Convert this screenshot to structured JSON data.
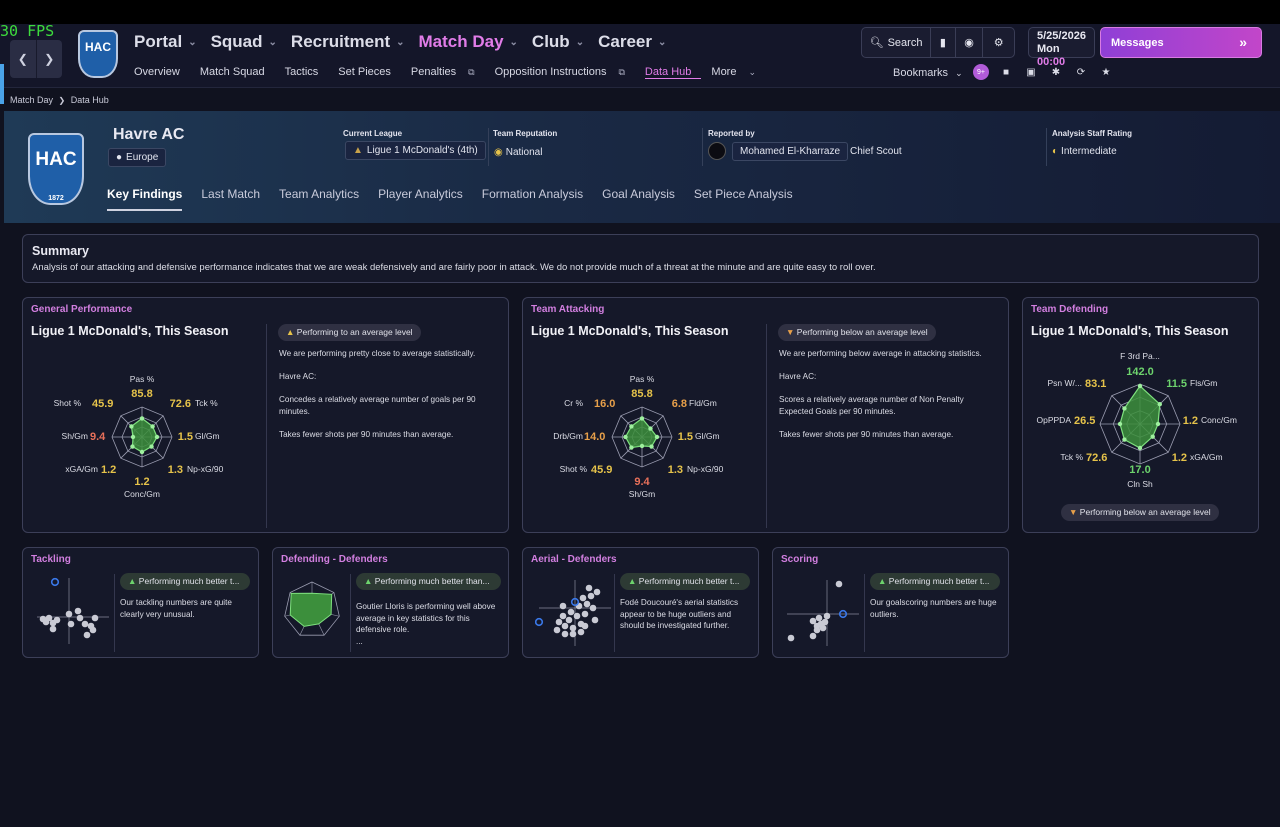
{
  "fps": "30 FPS",
  "nav": {
    "club_crest_text": "HAC",
    "menus": [
      {
        "label": "Portal"
      },
      {
        "label": "Squad"
      },
      {
        "label": "Recruitment"
      },
      {
        "label": "Match Day",
        "active": true
      },
      {
        "label": "Club"
      },
      {
        "label": "Career"
      }
    ],
    "submenu": [
      {
        "label": "Overview"
      },
      {
        "label": "Match Squad"
      },
      {
        "label": "Tactics"
      },
      {
        "label": "Set Pieces"
      },
      {
        "label": "Penalties",
        "external": true
      },
      {
        "label": "Opposition Instructions",
        "external": true
      },
      {
        "label": "Data Hub",
        "active": true
      },
      {
        "label": "More"
      }
    ],
    "search_label": "Search",
    "date": "5/25/2026",
    "day": "Mon",
    "time": "00:00",
    "messages_label": "Messages",
    "bookmarks_label": "Bookmarks",
    "notif_count": "9+"
  },
  "breadcrumb": {
    "parent": "Match Day",
    "current": "Data Hub"
  },
  "header": {
    "crest_text": "HAC",
    "crest_year": "1872",
    "club_name": "Havre AC",
    "region": "Europe",
    "current_league_label": "Current League",
    "current_league": "Ligue 1 McDonald's (4th)",
    "reputation_label": "Team Reputation",
    "reputation": "National",
    "reported_by_label": "Reported by",
    "scout_name": "Mohamed El-Kharraze",
    "scout_role": "Chief Scout",
    "staff_rating_label": "Analysis Staff Rating",
    "staff_rating": "Intermediate"
  },
  "tabs": [
    "Key Findings",
    "Last Match",
    "Team Analytics",
    "Player Analytics",
    "Formation Analysis",
    "Goal Analysis",
    "Set Piece Analysis"
  ],
  "summary": {
    "title": "Summary",
    "text": "Analysis of our attacking and defensive performance indicates that we are weak defensively and are fairly poor in attack. We do not provide much of a threat at the minute and are quite easy to roll over."
  },
  "general": {
    "title": "General Performance",
    "subtitle": "Ligue 1 McDonald's, This Season",
    "badge": "Performing to an average level",
    "lines": [
      "We are performing pretty close to average statistically.",
      "Havre AC:",
      "Concedes a relatively average number of goals per 90 minutes.",
      "Takes fewer shots per 90 minutes than average."
    ],
    "radar": [
      {
        "label": "Pas %",
        "value": "85.8",
        "color": "#e6c34a",
        "level": 0.62
      },
      {
        "label": "Tck %",
        "value": "72.6",
        "color": "#e6c34a",
        "level": 0.5
      },
      {
        "label": "Gl/Gm",
        "value": "1.5",
        "color": "#e6c34a",
        "level": 0.5
      },
      {
        "label": "Np-xG/90",
        "value": "1.3",
        "color": "#e6c34a",
        "level": 0.45
      },
      {
        "label": "Conc/Gm",
        "value": "1.2",
        "color": "#e6c34a",
        "level": 0.5
      },
      {
        "label": "xGA/Gm",
        "value": "1.2",
        "color": "#e6c34a",
        "level": 0.45
      },
      {
        "label": "Sh/Gm",
        "value": "9.4",
        "color": "#e8705a",
        "level": 0.3
      },
      {
        "label": "Shot %",
        "value": "45.9",
        "color": "#e6c34a",
        "level": 0.5
      }
    ]
  },
  "attacking": {
    "title": "Team Attacking",
    "subtitle": "Ligue 1 McDonald's, This Season",
    "badge": "Performing below an average level",
    "lines": [
      "We are performing below average in attacking statistics.",
      "Havre AC:",
      "Scores a relatively average number of Non Penalty Expected Goals per 90 minutes.",
      "Takes fewer shots per 90 minutes than average."
    ],
    "radar": [
      {
        "label": "Pas %",
        "value": "85.8",
        "color": "#e6c34a",
        "level": 0.62
      },
      {
        "label": "Fld/Gm",
        "value": "6.8",
        "color": "#e8a04a",
        "level": 0.4
      },
      {
        "label": "Gl/Gm",
        "value": "1.5",
        "color": "#e6c34a",
        "level": 0.5
      },
      {
        "label": "Np-xG/90",
        "value": "1.3",
        "color": "#e6c34a",
        "level": 0.45
      },
      {
        "label": "Sh/Gm",
        "value": "9.4",
        "color": "#e8705a",
        "level": 0.3
      },
      {
        "label": "Shot %",
        "value": "45.9",
        "color": "#e6c34a",
        "level": 0.5
      },
      {
        "label": "Drb/Gm",
        "value": "14.0",
        "color": "#e8a04a",
        "level": 0.55
      },
      {
        "label": "Cr %",
        "value": "16.0",
        "color": "#e8a04a",
        "level": 0.5
      }
    ]
  },
  "defending": {
    "title": "Team Defending",
    "subtitle": "Ligue 1 McDonald's, This Season",
    "badge": "Performing below an average level",
    "radar": [
      {
        "label": "F 3rd Pa...",
        "value": "142.0",
        "color": "#6dd36d",
        "level": 0.95
      },
      {
        "label": "Fls/Gm",
        "value": "11.5",
        "color": "#6dd36d",
        "level": 0.7
      },
      {
        "label": "Conc/Gm",
        "value": "1.2",
        "color": "#e6c34a",
        "level": 0.45
      },
      {
        "label": "xGA/Gm",
        "value": "1.2",
        "color": "#e6c34a",
        "level": 0.45
      },
      {
        "label": "Cln Sh",
        "value": "17.0",
        "color": "#6dd36d",
        "level": 0.6
      },
      {
        "label": "Tck %",
        "value": "72.6",
        "color": "#e6c34a",
        "level": 0.55
      },
      {
        "label": "OpPPDA",
        "value": "26.5",
        "color": "#e6c34a",
        "level": 0.5
      },
      {
        "label": "Psn W/...",
        "value": "83.1",
        "color": "#e6c34a",
        "level": 0.55
      }
    ]
  },
  "cards": [
    {
      "title": "Tackling",
      "badge": "Performing much better t...",
      "text": "Our tackling numbers are quite clearly very unusual."
    },
    {
      "title": "Defending - Defenders",
      "badge": "Performing much better than...",
      "text": "Goutier Lloris is performing well above average in key statistics for this defensive role.",
      "more": "..."
    },
    {
      "title": "Aerial - Defenders",
      "badge": "Performing much better t...",
      "text": "Fodé Doucouré's aerial statistics appear to be huge outliers and should be investigated further."
    },
    {
      "title": "Scoring",
      "badge": "Performing much better t...",
      "text": "Our goalscoring numbers are huge outliers."
    }
  ],
  "colors": {
    "accent": "#e17ce8",
    "radar_fill": "#3c8f3c",
    "radar_stroke": "#7ee07e",
    "panel_border": "#3c3f58"
  }
}
